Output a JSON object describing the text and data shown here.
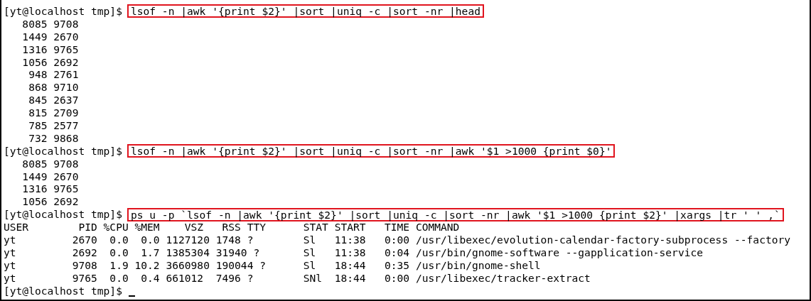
{
  "terminal": {
    "lines": [
      {
        "kind": "prompt",
        "prompt": "[yt@localhost tmp]$",
        "command": "lsof -n |awk '{print $2}' |sort |uniq -c |sort -nr |head",
        "highlighted": true,
        "cursor": false
      },
      {
        "kind": "output",
        "text": "   8085 9708"
      },
      {
        "kind": "output",
        "text": "   1449 2670"
      },
      {
        "kind": "output",
        "text": "   1316 9765"
      },
      {
        "kind": "output",
        "text": "   1056 2692"
      },
      {
        "kind": "output",
        "text": "    948 2761"
      },
      {
        "kind": "output",
        "text": "    868 9710"
      },
      {
        "kind": "output",
        "text": "    845 2637"
      },
      {
        "kind": "output",
        "text": "    815 2709"
      },
      {
        "kind": "output",
        "text": "    785 2577"
      },
      {
        "kind": "output",
        "text": "    732 9868"
      },
      {
        "kind": "prompt",
        "prompt": "[yt@localhost tmp]$",
        "command": "lsof -n |awk '{print $2}' |sort |uniq -c |sort -nr |awk '$1 >1000 {print $0}'",
        "highlighted": true,
        "cursor": false
      },
      {
        "kind": "output",
        "text": "   8085 9708"
      },
      {
        "kind": "output",
        "text": "   1449 2670"
      },
      {
        "kind": "output",
        "text": "   1316 9765"
      },
      {
        "kind": "output",
        "text": "   1056 2692"
      },
      {
        "kind": "prompt",
        "prompt": "[yt@localhost tmp]$",
        "command": "ps u -p `lsof -n |awk '{print $2}' |sort |uniq -c |sort -nr |awk '$1 >1000 {print $2}' |xargs |tr ' ' ,`",
        "highlighted": true,
        "cursor": false
      },
      {
        "kind": "output",
        "text": "USER        PID %CPU %MEM    VSZ   RSS TTY      STAT START   TIME COMMAND"
      },
      {
        "kind": "output",
        "text": "yt         2670  0.0  0.0 1127120 1748 ?        Sl   11:38   0:00 /usr/libexec/evolution-calendar-factory-subprocess --factory"
      },
      {
        "kind": "output",
        "text": "yt         2692  0.0  1.7 1385304 31940 ?       Sl   11:38   0:04 /usr/bin/gnome-software --gapplication-service"
      },
      {
        "kind": "output",
        "text": "yt         9708  1.9 10.2 3660980 190044 ?      Sl   18:44   0:35 /usr/bin/gnome-shell"
      },
      {
        "kind": "output",
        "text": "yt         9765  0.0  0.4 661012  7496 ?        SNl  18:44   0:00 /usr/libexec/tracker-extract"
      },
      {
        "kind": "prompt",
        "prompt": "[yt@localhost tmp]$",
        "highlighted": false,
        "cursor": true
      }
    ]
  }
}
